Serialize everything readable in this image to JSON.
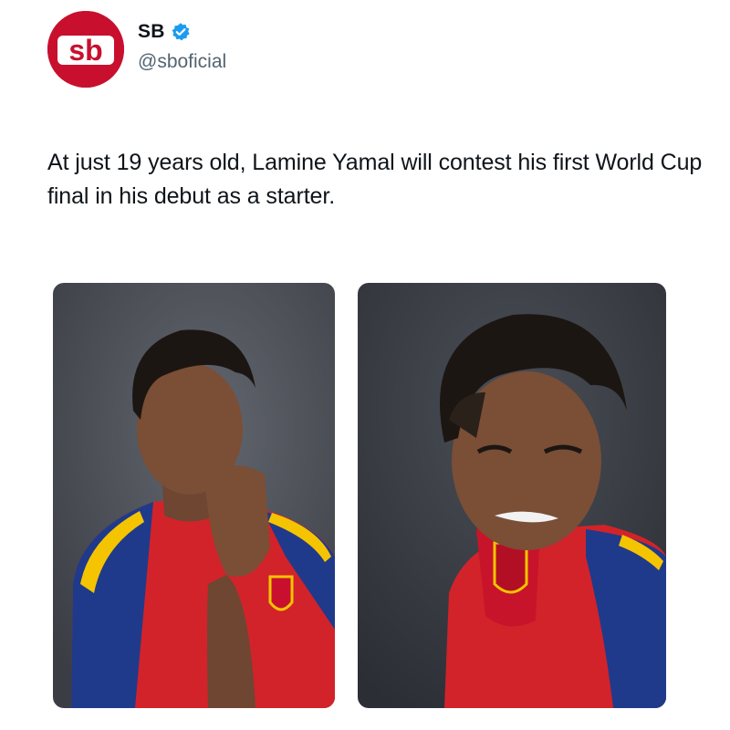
{
  "tweet": {
    "author": {
      "display_name": "SB",
      "handle": "@sboficial",
      "avatar_text": "sb",
      "verified": true,
      "avatar_color": "#c8102e",
      "verified_color": "#1d9bf0"
    },
    "text": "At just 19 years old, Lamine Yamal will contest his first World Cup final in his debut as a starter.",
    "media": [
      {
        "name": "left-photo"
      },
      {
        "name": "right-photo"
      }
    ]
  },
  "colors": {
    "text_primary": "#0f1419",
    "text_secondary": "#536471",
    "jersey_red": "#d2232a",
    "jersey_blue": "#1f3a8a",
    "jersey_yellow": "#f5c400",
    "photo_bg": "#4b4f58"
  },
  "icons": [
    "verified-badge-icon"
  ]
}
